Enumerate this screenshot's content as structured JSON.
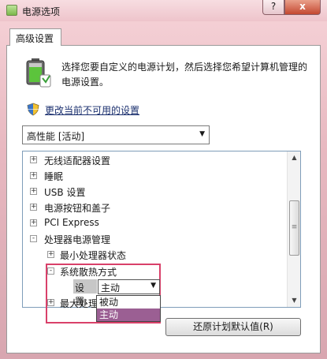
{
  "window": {
    "title": "电源选项",
    "help_label": "?",
    "close_label": "x"
  },
  "tab": {
    "label": "高级设置"
  },
  "description": "选择您要自定义的电源计划，然后选择您希望计算机管理的电源设置。",
  "change_link": "更改当前不可用的设置",
  "plan_select": {
    "value": "高性能 [活动]"
  },
  "tree": {
    "items": [
      {
        "label": "无线适配器设置",
        "expander": "+"
      },
      {
        "label": "睡眠",
        "expander": "+"
      },
      {
        "label": "USB 设置",
        "expander": "+"
      },
      {
        "label": "电源按钮和盖子",
        "expander": "+"
      },
      {
        "label": "PCI Express",
        "expander": "+"
      },
      {
        "label": "处理器电源管理",
        "expander": "-"
      },
      {
        "label": "最小处理器状态",
        "expander": "+"
      },
      {
        "label": "系统散热方式",
        "expander": "-"
      },
      {
        "label": "最大处理",
        "expander": "+"
      }
    ]
  },
  "setting": {
    "label": "设置:",
    "value": "主动",
    "options": [
      "被动",
      "主动"
    ],
    "selected_option": "主动"
  },
  "restore_button": "还原计划默认值(R)",
  "colors": {
    "accent_highlight": "#d9406a",
    "selected_option": "#9b5f93",
    "link": "#1a2f6e"
  }
}
